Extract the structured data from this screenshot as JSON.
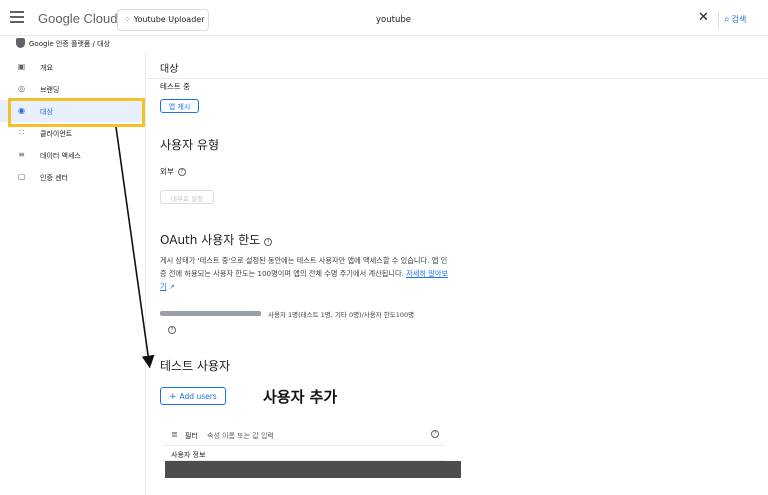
{
  "header": {
    "logo_google": "Google",
    "logo_cloud": " Cloud",
    "project_name": "Youtube Uploader",
    "search_value": "youtube",
    "search_clear": "✕",
    "search_button": "검색"
  },
  "breadcrumb": {
    "text": "Google 인증 플랫폼 / 대상"
  },
  "sidebar": {
    "items": [
      {
        "label": "개요",
        "icon": "dashboard-icon"
      },
      {
        "label": "브랜딩",
        "icon": "palette-icon"
      },
      {
        "label": "대상",
        "icon": "person-icon"
      },
      {
        "label": "클라이언트",
        "icon": "grid-icon"
      },
      {
        "label": "데이터 액세스",
        "icon": "data-access-icon"
      },
      {
        "label": "인증 센터",
        "icon": "verification-icon"
      }
    ],
    "active_index": 2
  },
  "main": {
    "page_title": "대상",
    "publish_status_label": "테스트 중",
    "publish_button": "앱 게시",
    "user_type_heading": "사용자 유형",
    "user_type_value": "외부",
    "make_internal_button": "내부로 설정",
    "oauth_heading": "OAuth 사용자 한도",
    "oauth_desc": "게시 상태가 '테스트 중'으로 설정된 동안에는 테스트 사용자만 앱에 액세스할 수 있습니다. 앱 인증 전에 허용되는 사용자 한도는 100명이며 앱의 전체 수명 주기에서 계산됩니다. ",
    "learn_more": "자세히 알아보기",
    "quota_text": "사용자 1명(테스트 1명, 기타 0명)/사용자 한도100명",
    "quota_fraction": 0.01,
    "test_users_heading": "테스트 사용자",
    "add_users_button": "Add users",
    "annotation": "사용자 추가",
    "filter_label": "필터",
    "filter_placeholder": "속성 이름 또는 값 입력",
    "column_user_info": "사용자 정보"
  },
  "colors": {
    "accent": "#1a73e8",
    "highlight": "#f6c026"
  }
}
